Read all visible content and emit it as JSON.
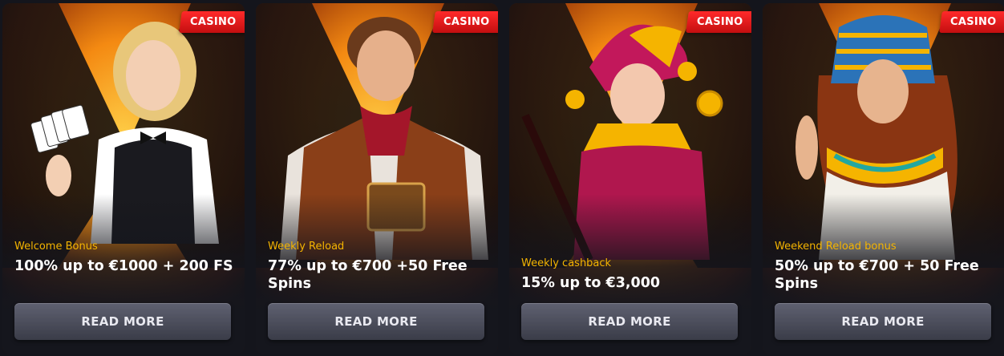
{
  "cards": [
    {
      "badge": "CASINO",
      "subtitle": "Welcome Bonus",
      "title": "100% up to €1000 + 200 FS",
      "button": "READ MORE",
      "illustration": "dealer-woman-with-cards",
      "bg_color": "#f08a10"
    },
    {
      "badge": "CASINO",
      "subtitle": "Weekly Reload",
      "title": "77% up to €700 +50 Free Spins",
      "button": "READ MORE",
      "illustration": "adventurer-man-with-book",
      "bg_color": "#f08a10"
    },
    {
      "badge": "CASINO",
      "subtitle": "Weekly cashback",
      "title": "15% up to €3,000",
      "button": "READ MORE",
      "illustration": "jester-woman-with-coin",
      "bg_color": "#f08a10"
    },
    {
      "badge": "CASINO",
      "subtitle": "Weekend Reload bonus",
      "title": "50% up to €700 + 50 Free Spins",
      "button": "READ MORE",
      "illustration": "pharaoh-queen",
      "bg_color": "#f08a10"
    }
  ],
  "colors": {
    "badge": "#e11a1a",
    "subtitle": "#f4b400",
    "title": "#ffffff",
    "button": "#4a4c5a"
  }
}
